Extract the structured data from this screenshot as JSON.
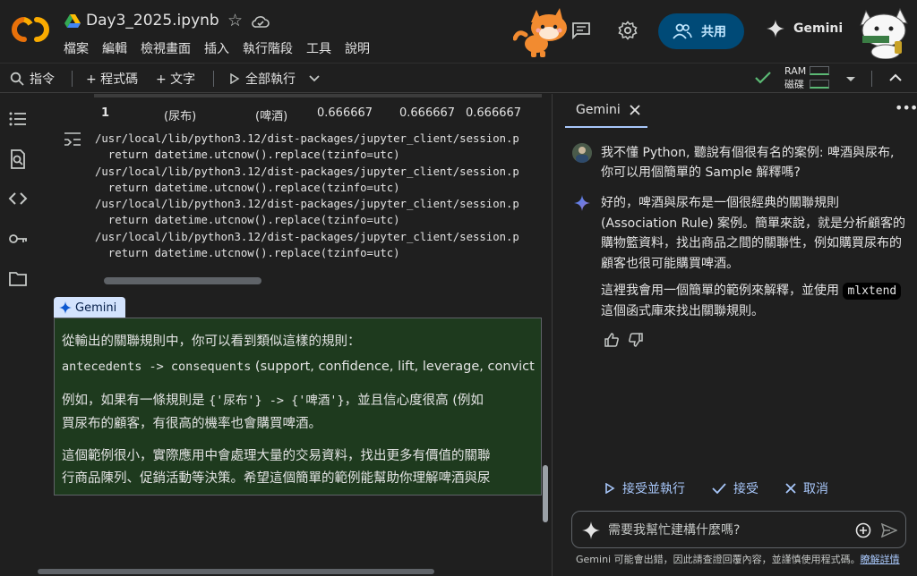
{
  "header": {
    "file_title": "Day3_2025.ipynb",
    "menu": [
      "檔案",
      "編輯",
      "檢視畫面",
      "插入",
      "執行階段",
      "工具",
      "說明"
    ],
    "share_label": "共用",
    "gemini_label": "Gemini"
  },
  "toolbar": {
    "command": "指令",
    "add_code": "+ 程式碼",
    "add_text": "+ 文字",
    "run_all": "全部執行",
    "ram": "RAM",
    "disk": "磁碟"
  },
  "output": {
    "row": {
      "index": "1",
      "antecedent": "(尿布)",
      "consequent": "(啤酒)",
      "v1": "0.666667",
      "v2": "0.666667",
      "v3": "0.666667"
    },
    "log_lines": [
      "/usr/local/lib/python3.12/dist-packages/jupyter_client/session.p",
      "  return datetime.utcnow().replace(tzinfo=utc)",
      "/usr/local/lib/python3.12/dist-packages/jupyter_client/session.p",
      "  return datetime.utcnow().replace(tzinfo=utc)",
      "/usr/local/lib/python3.12/dist-packages/jupyter_client/session.p",
      "  return datetime.utcnow().replace(tzinfo=utc)",
      "/usr/local/lib/python3.12/dist-packages/jupyter_client/session.p",
      "  return datetime.utcnow().replace(tzinfo=utc)"
    ]
  },
  "text_cell": {
    "chip": "Gemini",
    "p1": "從輸出的關聯規則中，你可以看到類似這樣的規則：",
    "p2_code": "antecedents -> consequents",
    "p2_rest": " (support, confidence, lift, leverage, convict",
    "p3_a": "例如，如果有一條規則是 ",
    "p3_code": "{'尿布'} -> {'啤酒'}",
    "p3_b": "，並且信心度很高 (例如",
    "p3_line2": "買尿布的顧客，有很高的機率也會購買啤酒。",
    "p4_line1": "這個範例很小，實際應用中會處理大量的交易資料，找出更多有價值的關聯",
    "p4_line2": "行商品陳列、促銷活動等決策。希望這個簡單的範例能幫助你理解啤酒與尿"
  },
  "panel": {
    "tab_label": "Gemini",
    "user_message": "我不懂 Python, 聽說有個很有名的案例: 啤酒與尿布, 你可以用個簡單的 Sample 解釋嗎?",
    "reply_p1": "好的，啤酒與尿布是一個很經典的關聯規則 (Association Rule) 案例。簡單來說，就是分析顧客的購物籃資料，找出商品之間的關聯性，例如購買尿布的顧客也很可能購買啤酒。",
    "reply_p2_a": "這裡我會用一個簡單的範例來解釋，並使用 ",
    "reply_p2_code": "mlxtend",
    "reply_p2_b": " 這個函式庫來找出關聯規則。",
    "accept_run": "接受並執行",
    "accept": "接受",
    "cancel": "取消",
    "ask_placeholder": "需要我幫忙建構什麼嗎?",
    "footnote": "Gemini 可能會出錯，因此請查證回覆內容，並謹慎使用程式碼。",
    "footnote_link": "瞭解詳情"
  },
  "colors": {
    "background": "#1f1f1f",
    "accent": "#a8c7fa",
    "share_button": "#004a77",
    "text_cell_bg": "#1e3a1e",
    "ok_green": "#5bb974"
  }
}
